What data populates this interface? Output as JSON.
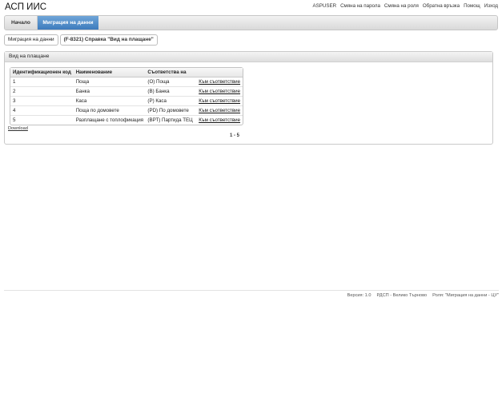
{
  "app": {
    "title": "АСП ИИС"
  },
  "top_links": [
    "ASPUSER",
    "Смяна на парола",
    "Смяна на роля",
    "Обратна връзка",
    "Помощ",
    "Изход"
  ],
  "nav": {
    "home": "Начало",
    "active": "Миграция на данни"
  },
  "breadcrumb": {
    "parent": "Миграция на данни",
    "current": "(F-8321) Справка \"Вид на плащане\""
  },
  "panel": {
    "title": "Вид на плащане"
  },
  "table": {
    "headers": [
      "Идентификационен код",
      "Наименование",
      "Съответства на",
      ""
    ],
    "rows": [
      {
        "id": "1",
        "name": "Поща",
        "match": "(О) Поща",
        "link": "Към съответствие"
      },
      {
        "id": "2",
        "name": "Банка",
        "match": "(В) Банка",
        "link": "Към съответствие"
      },
      {
        "id": "3",
        "name": "Каса",
        "match": "(Р) Каса",
        "link": "Към съответствие"
      },
      {
        "id": "4",
        "name": "Поща по домовете",
        "match": "(PD) По домовете",
        "link": "Към съответствие"
      },
      {
        "id": "5",
        "name": "Разплащане с топлофикация",
        "match": "(ВРТ) Партида ТЕЦ",
        "link": "Към съответствие"
      }
    ]
  },
  "download_label": "Download",
  "pager": "1 - 5",
  "footer": {
    "version": "Версия: 1.0",
    "org": "РДСП - Велико Търново",
    "role": "Роля: \"Миграция на данни - ЦУ\""
  }
}
